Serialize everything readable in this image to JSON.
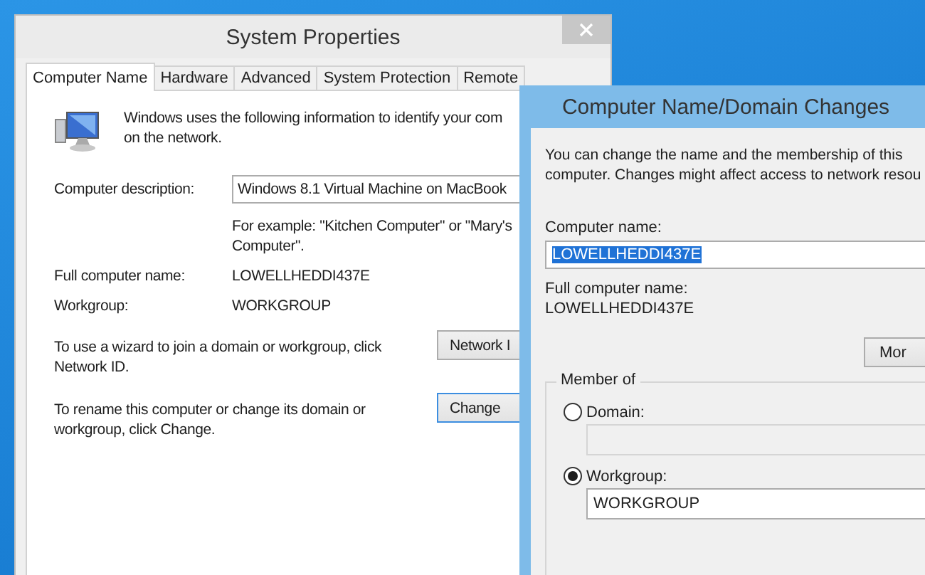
{
  "system_properties": {
    "title": "System Properties",
    "active": false,
    "tabs": [
      {
        "label": "Computer Name",
        "selected": true
      },
      {
        "label": "Hardware",
        "selected": false
      },
      {
        "label": "Advanced",
        "selected": false
      },
      {
        "label": "System Protection",
        "selected": false
      },
      {
        "label": "Remote",
        "selected": false
      }
    ],
    "intro": "Windows uses the following information to identify your com\non the network.",
    "description": {
      "label": "Computer description:",
      "value": "Windows 8.1 Virtual Machine on MacBook"
    },
    "example": "For example: \"Kitchen Computer\" or \"Mary's\nComputer\".",
    "full_name": {
      "label": "Full computer name:",
      "value": "LOWELLHEDDI437E"
    },
    "workgroup": {
      "label": "Workgroup:",
      "value": "WORKGROUP"
    },
    "actions": [
      {
        "text": "To use a wizard to join a domain or workgroup, click\nNetwork ID.",
        "button": "Network I",
        "focused": false
      },
      {
        "text": "To rename this computer or change its domain or\nworkgroup, click Change.",
        "button": "Change",
        "focused": true
      }
    ]
  },
  "dialog": {
    "title": "Computer Name/Domain Changes",
    "active": true,
    "intro": "You can change the name and the membership of this\ncomputer. Changes might affect access to network resou",
    "computer_name": {
      "label": "Computer name:",
      "value": "LOWELLHEDDI437E",
      "selected": true
    },
    "full_name": {
      "label": "Full computer name:",
      "value": "LOWELLHEDDI437E"
    },
    "more_button": "Mor",
    "member_of": {
      "legend": "Member of",
      "options": [
        {
          "label": "Domain:",
          "selected": false
        },
        {
          "label": "Workgroup:",
          "selected": true,
          "value": "WORKGROUP"
        }
      ]
    }
  }
}
